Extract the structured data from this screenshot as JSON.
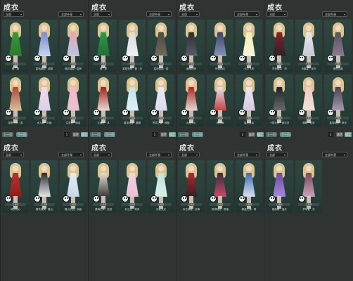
{
  "panels": [
    {
      "title": "成衣",
      "filter_left": "全部",
      "filter_right": "全部外观",
      "page": "1",
      "prev": "上一页",
      "next": "下一页",
      "jump": "跳转",
      "ok": "确定",
      "items": [
        {
          "tag": "已拥有",
          "name": "蝶 · 冠",
          "colors": [
            "#3a9a3a",
            "#2b7a2b"
          ]
        },
        {
          "tag": "已拥有",
          "name": "星轨翩跹 · 绒翅",
          "colors": [
            "#7a8ad0",
            "#c9d4f2"
          ]
        },
        {
          "tag": "已拥有",
          "name": "漫游谣曲 · 星眸",
          "colors": [
            "#e7a6b8",
            "#b7c6df"
          ]
        },
        {
          "tag": "已拥有",
          "name": "绮梦月华 · 宵",
          "colors": [
            "#b3453a",
            "#d8c3a0"
          ]
        },
        {
          "tag": "已拥有",
          "name": "水人雅 · 月画",
          "colors": [
            "#f2dbe6",
            "#d9cfe9"
          ]
        },
        {
          "tag": "已拥有",
          "name": "住梦初 · 情话",
          "colors": [
            "#f3b9c8",
            "#e8c1cf"
          ]
        }
      ]
    },
    {
      "title": "成衣",
      "filter_left": "全部",
      "filter_right": "全部外观",
      "page": "1",
      "prev": "上一页",
      "next": "下一页",
      "jump": "跳转",
      "ok": "确定",
      "items": [
        {
          "tag": "已拥有",
          "name": "蝶 · 翠",
          "colors": [
            "#2f9a4a",
            "#1f6e34"
          ]
        },
        {
          "tag": "已拥有",
          "name": "星愿琴音 · 奏 · 永",
          "colors": [
            "#d9dde2",
            "#eef0f2"
          ]
        },
        {
          "tag": "已拥有",
          "name": "星夜轻描 · 韵",
          "colors": [
            "#4a4a44",
            "#706b5a"
          ]
        },
        {
          "tag": "已拥有",
          "name": "云裳彩 · 沐",
          "colors": [
            "#a81f1f",
            "#e9dfd6"
          ]
        },
        {
          "tag": "已拥有",
          "name": "碧波轻漾 · 晨曦",
          "colors": [
            "#bfe3ee",
            "#dff1f5"
          ]
        },
        {
          "tag": "已拥有",
          "name": "梦境之舞 · 慢板",
          "colors": [
            "#eaeaf3",
            "#dcdcef"
          ]
        }
      ]
    },
    {
      "title": "成衣",
      "filter_left": "全部",
      "filter_right": "全部外观",
      "page": "2",
      "prev": "上一页",
      "next": "下一页",
      "jump": "跳转",
      "ok": "确定",
      "items": [
        {
          "tag": "已拥有",
          "name": "幽暗神宫",
          "colors": [
            "#2c2c34",
            "#5c5c6c"
          ]
        },
        {
          "tag": "已拥有",
          "name": "怪诞相约",
          "colors": [
            "#3a4468",
            "#8a94b8"
          ]
        },
        {
          "tag": "已拥有",
          "name": "云中飞鸢",
          "colors": [
            "#f2f0b8",
            "#f7f4d8"
          ]
        },
        {
          "tag": "已拥有",
          "name": "赤焰天心",
          "colors": [
            "#b02828",
            "#e4dcd0"
          ]
        },
        {
          "tag": "已拥有",
          "name": "缥缈舞",
          "colors": [
            "#e6e2ee",
            "#c83c3c"
          ]
        },
        {
          "tag": "已拥有",
          "name": "星辰童话",
          "colors": [
            "#efe6f0",
            "#d8c8e0"
          ]
        }
      ]
    },
    {
      "title": "成衣",
      "filter_left": "全部",
      "filter_right": "全部外观",
      "page": "2",
      "prev": "上一页",
      "next": "下一页",
      "jump": "跳转",
      "ok": "确定",
      "items": [
        {
          "tag": "已拥有",
          "name": "灵夜幽影 · 初",
          "colors": [
            "#8a1f28",
            "#2a2226"
          ]
        },
        {
          "tag": "已拥有",
          "name": "光翼星 · 瑶光",
          "colors": [
            "#e8e8ee",
            "#c8c8d4"
          ]
        },
        {
          "tag": "已拥有",
          "name": "琥珀沉晶",
          "colors": [
            "#5a5060",
            "#8a7a92"
          ]
        },
        {
          "tag": "已拥有",
          "name": "十载长夜 · 寂沉浮",
          "colors": [
            "#222226",
            "#6a6a70"
          ]
        },
        {
          "tag": "已拥有",
          "name": "暖阳 · 夏彩",
          "colors": [
            "#f3c9c4",
            "#f0e0d6"
          ]
        },
        {
          "tag": "已拥有",
          "name": "星辰绮夜 · 夜光",
          "colors": [
            "#4c4254",
            "#a89cb0"
          ]
        }
      ]
    },
    {
      "title": "成衣",
      "filter_left": "全部",
      "filter_right": "全部外观",
      "page": "",
      "prev": "",
      "next": "",
      "jump": "",
      "ok": "",
      "items": [
        {
          "tag": "已拥有",
          "name": "绮罗相心",
          "colors": [
            "#c0302c",
            "#8c1e1c"
          ]
        },
        {
          "tag": "已拥有",
          "name": "雪衣清漪 · 春山",
          "colors": [
            "#2a2a2e",
            "#e8e6ea"
          ]
        },
        {
          "tag": "已拥有",
          "name": "雪山乐园 · 序曲",
          "colors": [
            "#e4ecf3",
            "#c6d8ea"
          ]
        }
      ]
    },
    {
      "title": "成衣",
      "filter_left": "全部",
      "filter_right": "全部外观",
      "page": "",
      "prev": "",
      "next": "",
      "jump": "",
      "ok": "",
      "items": [
        {
          "tag": "已拥有",
          "name": "潇湘花水 · 花冠",
          "colors": [
            "#e8e2d6",
            "#3a3a3a"
          ]
        },
        {
          "tag": "已拥有",
          "name": "彩云归 · 荷风",
          "colors": [
            "#f2d6e2",
            "#e8c0d2"
          ]
        },
        {
          "tag": "已拥有",
          "name": "月影流光",
          "colors": [
            "#bfe6dc",
            "#d8f0ea"
          ]
        }
      ]
    },
    {
      "title": "成衣",
      "filter_left": "全部",
      "filter_right": "全部外观",
      "page": "",
      "prev": "",
      "next": "",
      "jump": "",
      "ok": "",
      "items": [
        {
          "tag": "已拥有",
          "name": "赤玉满楼 · 红梅",
          "colors": [
            "#b8252e",
            "#2a2428"
          ]
        },
        {
          "tag": "已拥有",
          "name": "夜翎琉光 · 陨落",
          "colors": [
            "#3a2c3c",
            "#c84a6a"
          ]
        },
        {
          "tag": "已拥有",
          "name": "蔚蓝天海 · 晴",
          "colors": [
            "#3e6cb4",
            "#d8dff0"
          ]
        }
      ]
    },
    {
      "title": "成衣",
      "filter_left": "全部",
      "filter_right": "全部外观",
      "page": "",
      "prev": "",
      "next": "",
      "jump": "",
      "ok": "",
      "items": [
        {
          "tag": "已拥有",
          "name": "紫韵梅 · 遥月",
          "colors": [
            "#6c4aa8",
            "#a88ad8"
          ]
        },
        {
          "tag": "已拥有",
          "name": "梦华紫 · 花",
          "colors": [
            "#7a4a62",
            "#c8a2b6"
          ]
        }
      ]
    }
  ]
}
